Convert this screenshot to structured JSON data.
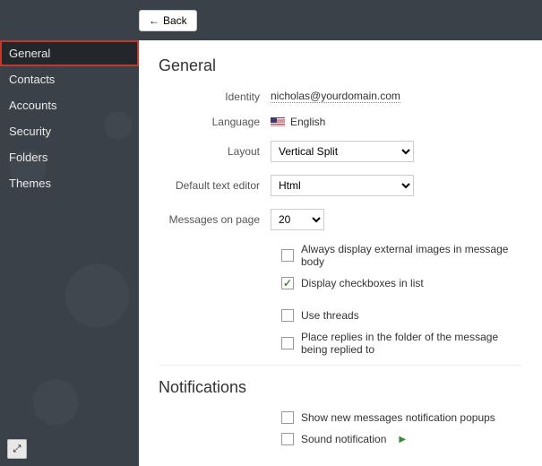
{
  "topbar": {
    "back_label": "Back"
  },
  "sidebar": {
    "items": [
      {
        "label": "General",
        "active": true
      },
      {
        "label": "Contacts",
        "active": false
      },
      {
        "label": "Accounts",
        "active": false
      },
      {
        "label": "Security",
        "active": false
      },
      {
        "label": "Folders",
        "active": false
      },
      {
        "label": "Themes",
        "active": false
      }
    ]
  },
  "general": {
    "title": "General",
    "identity_label": "Identity",
    "identity_value": "nicholas@yourdomain.com",
    "language_label": "Language",
    "language_value": "English",
    "layout_label": "Layout",
    "layout_value": "Vertical Split",
    "editor_label": "Default text editor",
    "editor_value": "Html",
    "mpp_label": "Messages on page",
    "mpp_value": "20",
    "cb_external_images": "Always display external images in message body",
    "cb_checkboxes_list": "Display checkboxes in list",
    "cb_use_threads": "Use threads",
    "cb_place_replies": "Place replies in the folder of the message being replied to"
  },
  "notifications": {
    "title": "Notifications",
    "cb_popups": "Show new messages notification popups",
    "cb_sound": "Sound notification"
  }
}
